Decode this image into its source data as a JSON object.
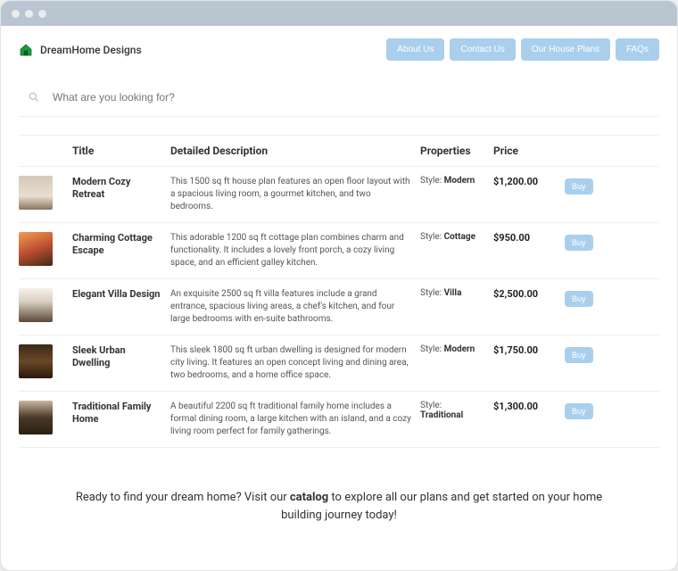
{
  "brand": {
    "name": "DreamHome Designs"
  },
  "nav": [
    "About Us",
    "Contact Us",
    "Our House Plans",
    "FAQs"
  ],
  "search": {
    "placeholder": "What are you looking for?"
  },
  "columns": {
    "title": "Title",
    "desc": "Detailed Description",
    "props": "Properties",
    "price": "Price"
  },
  "rows": [
    {
      "title": "Modern Cozy Retreat",
      "desc": "This 1500 sq ft house plan features an open floor layout with a spacious living room, a gourmet kitchen, and two bedrooms.",
      "style_label": "Style:",
      "style": "Modern",
      "price": "$1,200.00",
      "buy": "Buy",
      "thumb": "thumb1"
    },
    {
      "title": "Charming Cottage Escape",
      "desc": "This adorable 1200 sq ft cottage plan combines charm and functionality. It includes a lovely front porch, a cozy living space, and an efficient galley kitchen.",
      "style_label": "Style:",
      "style": "Cottage",
      "price": "$950.00",
      "buy": "Buy",
      "thumb": "thumb2"
    },
    {
      "title": "Elegant Villa Design",
      "desc": "An exquisite 2500 sq ft villa features include a grand entrance, spacious living areas, a chef's kitchen, and four large bedrooms with en-suite bathrooms.",
      "style_label": "Style:",
      "style": "Villa",
      "price": "$2,500.00",
      "buy": "Buy",
      "thumb": "thumb3"
    },
    {
      "title": "Sleek Urban Dwelling",
      "desc": "This sleek 1800 sq ft urban dwelling is designed for modern city living. It features an open concept living and dining area, two bedrooms, and a home office space.",
      "style_label": "Style:",
      "style": "Modern",
      "price": "$1,750.00",
      "buy": "Buy",
      "thumb": "thumb4"
    },
    {
      "title": "Traditional Family Home",
      "desc": "A beautiful 2200 sq ft traditional family home includes a formal dining room, a large kitchen with an island, and a cozy living room perfect for family gatherings.",
      "style_label": "Style:",
      "style": "Traditional",
      "price": "$1,300.00",
      "buy": "Buy",
      "thumb": "thumb5"
    }
  ],
  "footer": {
    "pre": "Ready to find your dream home? Visit our ",
    "bold": "catalog",
    "post": " to explore all our plans and get started on your home building journey today!"
  }
}
